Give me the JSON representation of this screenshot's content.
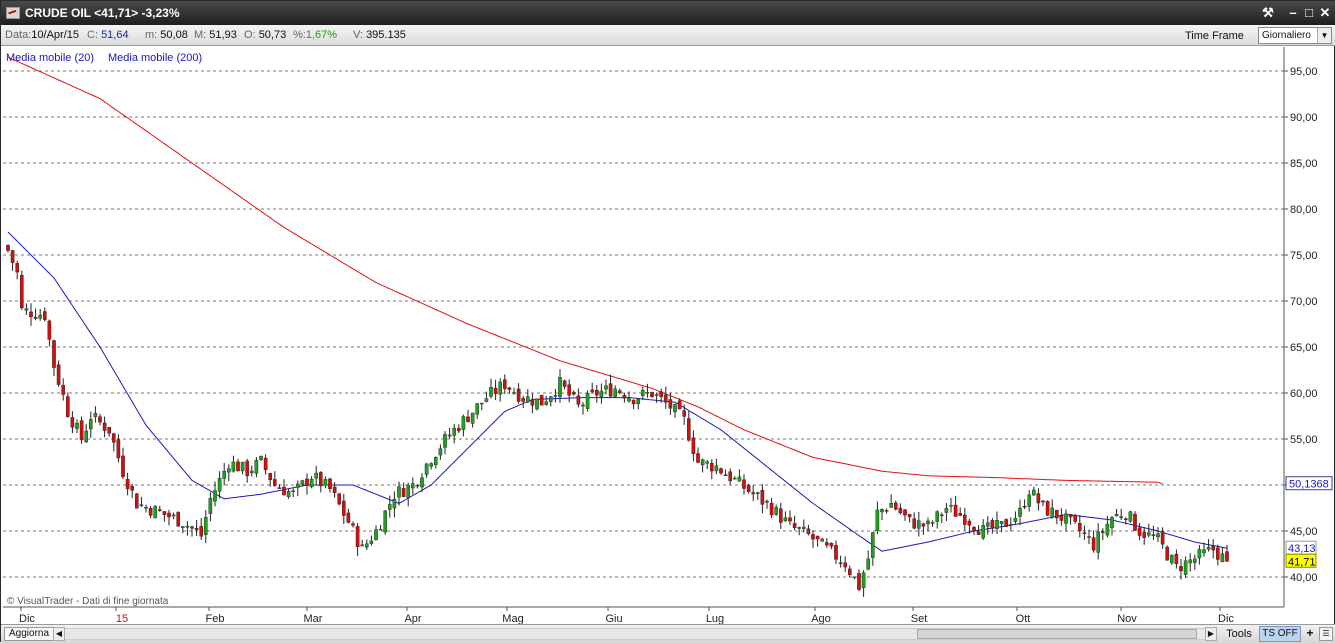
{
  "window": {
    "title": "CRUDE OIL <41,71> -3,23%"
  },
  "infobar": {
    "date_label": "Data:",
    "date_value": "10/Apr/15",
    "close_label": "C:",
    "close_value": "51,64",
    "low_label": "m:",
    "low_value": "50,08",
    "high_label": "M:",
    "high_value": "51,93",
    "open_label": "O:",
    "open_value": "50,73",
    "pct_label": "%:",
    "pct_value": "1,67%",
    "vol_label": "V:",
    "vol_value": "395.135",
    "timeframe_label": "Time Frame",
    "timeframe_value": "Giornaliero"
  },
  "legend": {
    "ma20": "Media mobile (20)",
    "ma200": "Media mobile (200)"
  },
  "watermark": "© VisualTrader - Dati di fine giornata",
  "price_tags": {
    "ma200_value": "50,1368",
    "ma20_value": "43,13",
    "last_price": "41,71"
  },
  "statusbar": {
    "refresh": "Aggiorna",
    "tools": "Tools",
    "ts": "TS OFF",
    "plus": "+"
  },
  "colors": {
    "up": "#1fa01f",
    "down": "#d01010",
    "ma20": "#1a1ab8",
    "ma200": "#e01010",
    "last_price_bg": "#ffff00",
    "grid": "#7a7a7a"
  },
  "chart_data": {
    "type": "candlestick",
    "title": "CRUDE OIL",
    "ylim": [
      37.5,
      97.5
    ],
    "y_ticks": [
      "95,00",
      "90,00",
      "85,00",
      "80,00",
      "75,00",
      "70,00",
      "65,00",
      "60,00",
      "55,00",
      "50,00",
      "45,00",
      "40,00"
    ],
    "x_ticks": [
      "Dic",
      "15",
      "Feb",
      "Mar",
      "Apr",
      "Mag",
      "Giu",
      "Lug",
      "Ago",
      "Set",
      "Ott",
      "Nov",
      "Dic"
    ],
    "x_tick_highlight": "15",
    "grid": true,
    "close_anchors": [
      [
        0,
        75.5
      ],
      [
        2,
        73.0
      ],
      [
        3,
        69.0
      ],
      [
        8,
        68.5
      ],
      [
        10,
        63.0
      ],
      [
        13,
        58.0
      ],
      [
        16,
        55.0
      ],
      [
        18,
        57.5
      ],
      [
        22,
        56.0
      ],
      [
        25,
        51.5
      ],
      [
        28,
        48.0
      ],
      [
        33,
        47.0
      ],
      [
        38,
        46.0
      ],
      [
        42,
        44.5
      ],
      [
        44,
        48.5
      ],
      [
        48,
        52.5
      ],
      [
        52,
        51.5
      ],
      [
        55,
        52.5
      ],
      [
        58,
        50.0
      ],
      [
        62,
        49.0
      ],
      [
        66,
        51.0
      ],
      [
        70,
        49.5
      ],
      [
        74,
        46.0
      ],
      [
        77,
        43.0
      ],
      [
        80,
        45.0
      ],
      [
        84,
        49.0
      ],
      [
        88,
        50.0
      ],
      [
        92,
        53.0
      ],
      [
        96,
        55.5
      ],
      [
        100,
        57.5
      ],
      [
        104,
        59.5
      ],
      [
        108,
        61.0
      ],
      [
        112,
        59.5
      ],
      [
        116,
        59.0
      ],
      [
        120,
        61.0
      ],
      [
        124,
        58.5
      ],
      [
        128,
        60.0
      ],
      [
        132,
        60.5
      ],
      [
        136,
        59.5
      ],
      [
        140,
        60.0
      ],
      [
        144,
        58.5
      ],
      [
        147,
        57.0
      ],
      [
        150,
        52.5
      ],
      [
        154,
        52.0
      ],
      [
        158,
        50.5
      ],
      [
        162,
        49.0
      ],
      [
        166,
        47.5
      ],
      [
        170,
        45.5
      ],
      [
        174,
        44.5
      ],
      [
        178,
        43.0
      ],
      [
        182,
        41.5
      ],
      [
        185,
        39.0
      ],
      [
        187,
        42.0
      ],
      [
        189,
        47.0
      ],
      [
        192,
        48.0
      ],
      [
        196,
        46.0
      ],
      [
        200,
        45.5
      ],
      [
        204,
        47.5
      ],
      [
        208,
        46.5
      ],
      [
        212,
        45.0
      ],
      [
        216,
        45.5
      ],
      [
        220,
        47.0
      ],
      [
        222,
        49.5
      ],
      [
        225,
        47.5
      ],
      [
        229,
        46.5
      ],
      [
        233,
        45.0
      ],
      [
        236,
        43.5
      ],
      [
        240,
        46.5
      ],
      [
        243,
        47.0
      ],
      [
        246,
        45.0
      ],
      [
        250,
        44.0
      ],
      [
        254,
        41.0
      ],
      [
        258,
        42.0
      ],
      [
        262,
        43.0
      ],
      [
        265,
        41.7
      ]
    ],
    "ma20_series": {
      "name": "Media mobile (20)",
      "anchors": [
        [
          0,
          77.5
        ],
        [
          10,
          72.5
        ],
        [
          20,
          65.0
        ],
        [
          30,
          56.5
        ],
        [
          40,
          50.5
        ],
        [
          47,
          48.5
        ],
        [
          55,
          49.0
        ],
        [
          65,
          50.0
        ],
        [
          75,
          50.0
        ],
        [
          85,
          48.0
        ],
        [
          92,
          50.0
        ],
        [
          100,
          54.0
        ],
        [
          108,
          58.0
        ],
        [
          114,
          59.3
        ],
        [
          125,
          59.5
        ],
        [
          135,
          59.5
        ],
        [
          145,
          59.0
        ],
        [
          155,
          56.0
        ],
        [
          165,
          52.0
        ],
        [
          175,
          48.0
        ],
        [
          185,
          44.5
        ],
        [
          190,
          42.8
        ],
        [
          200,
          43.8
        ],
        [
          210,
          45.0
        ],
        [
          220,
          45.8
        ],
        [
          230,
          46.8
        ],
        [
          240,
          46.2
        ],
        [
          250,
          45.0
        ],
        [
          258,
          43.8
        ],
        [
          265,
          43.13
        ]
      ]
    },
    "ma200_series": {
      "name": "Media mobile (200)",
      "anchors": [
        [
          0,
          96.5
        ],
        [
          20,
          92.0
        ],
        [
          40,
          85.0
        ],
        [
          60,
          78.0
        ],
        [
          80,
          72.0
        ],
        [
          100,
          67.5
        ],
        [
          120,
          63.5
        ],
        [
          140,
          60.5
        ],
        [
          150,
          58.5
        ],
        [
          160,
          56.0
        ],
        [
          175,
          53.0
        ],
        [
          190,
          51.5
        ],
        [
          200,
          51.0
        ],
        [
          215,
          50.8
        ],
        [
          230,
          50.5
        ],
        [
          250,
          50.3
        ],
        [
          251,
          50.1368
        ]
      ]
    }
  }
}
